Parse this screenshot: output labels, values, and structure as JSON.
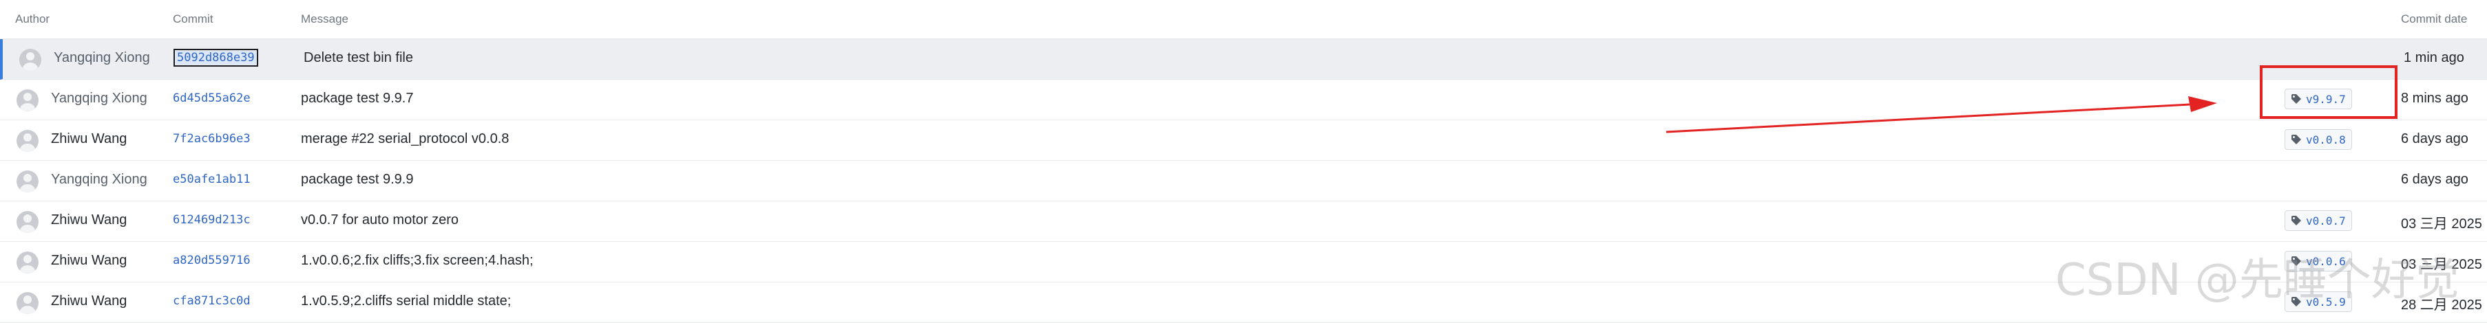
{
  "columns": {
    "author": "Author",
    "commit": "Commit",
    "message": "Message",
    "commit_date": "Commit date"
  },
  "commits": [
    {
      "author": "Yangqing Xiong",
      "hash": "5092d868e39",
      "message": "Delete test bin file",
      "tag": "",
      "date": "1 min ago"
    },
    {
      "author": "Yangqing Xiong",
      "hash": "6d45d55a62e",
      "message": "package test 9.9.7",
      "tag": "v9.9.7",
      "date": "8 mins ago"
    },
    {
      "author": "Zhiwu Wang",
      "hash": "7f2ac6b96e3",
      "message": "merage #22 serial_protocol v0.0.8",
      "tag": "v0.0.8",
      "date": "6 days ago"
    },
    {
      "author": "Yangqing Xiong",
      "hash": "e50afe1ab11",
      "message": "package test 9.9.9",
      "tag": "",
      "date": "6 days ago"
    },
    {
      "author": "Zhiwu Wang",
      "hash": "612469d213c",
      "message": "v0.0.7 for auto motor zero",
      "tag": "v0.0.7",
      "date": "03 三月 2025"
    },
    {
      "author": "Zhiwu Wang",
      "hash": "a820d559716",
      "message": "1.v0.0.6;2.fix cliffs;3.fix screen;4.hash;",
      "tag": "v0.0.6",
      "date": "03 三月 2025"
    },
    {
      "author": "Zhiwu Wang",
      "hash": "cfa871c3c0d",
      "message": "1.v0.5.9;2.cliffs serial middle state;",
      "tag": "v0.5.9",
      "date": "28 二月 2025"
    }
  ],
  "watermark": "CSDN @先睡个好觉",
  "colors": {
    "link": "#2f66c4",
    "annotation": "#e32222",
    "selected_row": "#eceef1"
  },
  "icons": {
    "tag": "tag-icon",
    "avatar": "avatar-placeholder"
  }
}
